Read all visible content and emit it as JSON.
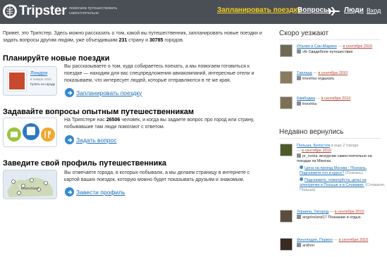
{
  "header": {
    "logo_text": "Tripster",
    "tagline": "помогаем путешествовать самостоятельно",
    "nav": {
      "plan": "Запланировать поездку",
      "questions": "Вопросы",
      "people": "Люди",
      "login": "Вход"
    },
    "colors": {
      "bar": "#4a4e55",
      "plan_link": "#f7d21f"
    }
  },
  "intro": {
    "before_countries": "Привет, это Трипстер. Здесь можно рассказать о том, какой вы путешественник, запланировать новые поездки и задать вопросы другим людям, уже объездившим",
    "countries": "231",
    "middle": "страну и",
    "cities": "30785",
    "after": "городов."
  },
  "sections": {
    "plan": {
      "title": "Планируйте новые поездки",
      "desc": "Вы рассказываете о том, куда собираетесь поехать, а мы помогаем готовиться к поездке — находим для вас спецпредложения авиакомпаний, интересные отели и показываем, что интересует людей, которые отправляются в те же края.",
      "cta": "Запланировать поездку",
      "thumb_city": "Лондон",
      "thumb_date": "в январе 2010",
      "thumb_caption": "Гулять по городу"
    },
    "ask": {
      "title": "Задавайте вопросы опытным путешественникам",
      "desc_before": "На Трипстере нас",
      "count": "26506",
      "desc_after": "человек, и когда вы задаете вопрос про город или страну, побывавшие там люди помогают с ответом.",
      "cta": "Задать вопрос"
    },
    "profile": {
      "title": "Заведите свой профиль путешественника",
      "desc": "Вы отмечаете города, в которых побывали, а мы делаем страницу в интернете с картой ваших поездок, которую можно будет показывать друзьям и знакомым.",
      "cta": "Завести профиль",
      "map_label": "Deutschland"
    }
  },
  "sidebar": {
    "soon_title": "Скоро уезжают",
    "soon": [
      {
        "place": "Италия и Сан-Марино",
        "when": "в сентябре 2010",
        "user": "vtk",
        "note": "Свадебное путешествие"
      },
      {
        "place": "Таиланд",
        "when": "в сентябре 2010",
        "user": "lineshka",
        "note": "отдыхать"
      },
      {
        "place": "Камбоджа",
        "when": "в сентябре 2010",
        "user": "lineshka",
        "note": ""
      }
    ],
    "back_title": "Недавно вернулись",
    "back": [
      {
        "place": "Польша, Белосток",
        "meta": "и еще 2 города",
        "when": "в сентябре 2010",
        "user": "pr_tonka",
        "note": "экскурсии самостоятельно на поездах из Минска",
        "links": [
          {
            "text": "Цена на проезд Москва - Познань. Подскажите кто в курсе?",
            "meta": "(Познань)"
          },
          {
            "text": "Подскажите, пожалуйста, цены на электрички в Польше и в Словакии.",
            "meta": "(Словакия, Польша)"
          }
        ]
      },
      {
        "place": "Украина, Ужгород",
        "when": "в сентябре 2010",
        "user": "angelroland17",
        "note": "Познание и отдых."
      },
      {
        "place": "Финляндия, Порвоо",
        "when": "в сентябре 2010",
        "user": "ardhon",
        "note": ""
      }
    ]
  }
}
